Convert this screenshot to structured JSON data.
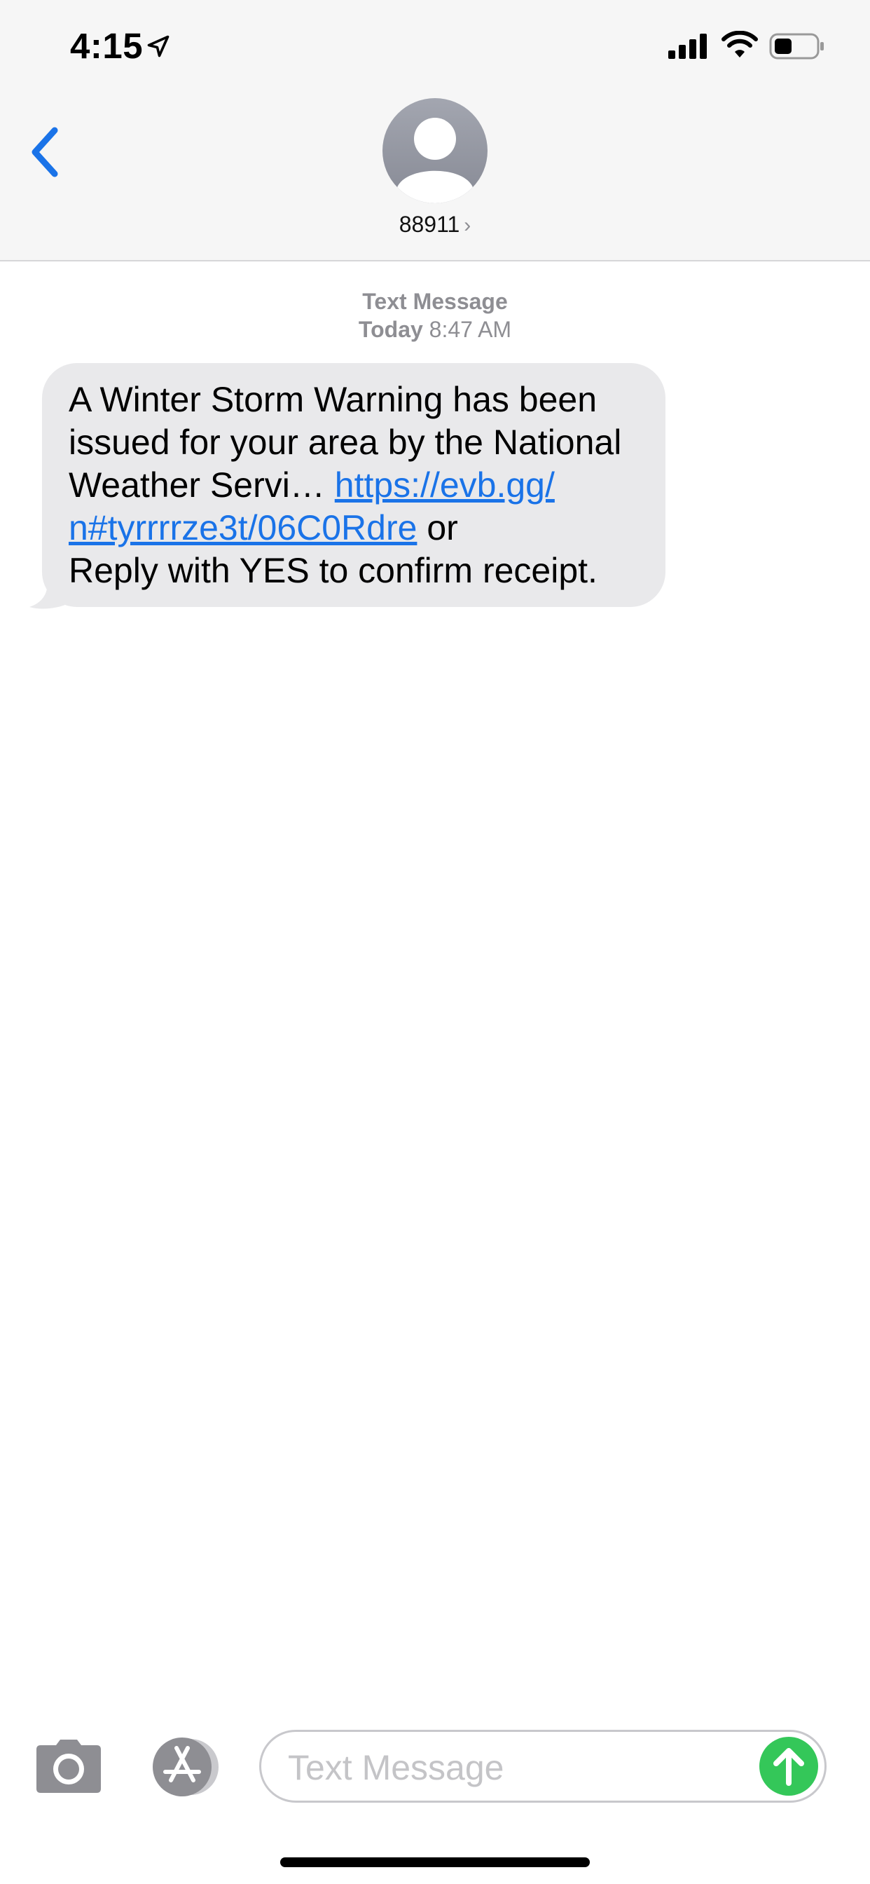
{
  "status_bar": {
    "time": "4:15",
    "icons": [
      "location-arrow-icon",
      "signal-icon",
      "wifi-icon",
      "battery-icon"
    ],
    "battery_level": 0.4
  },
  "header": {
    "back_icon": "chevron-left-icon",
    "avatar_icon": "person-icon",
    "contact_name": "88911",
    "contact_chevron": "›"
  },
  "conversation": {
    "service_label": "Text Message",
    "timestamp_day": "Today",
    "timestamp_time": "8:47 AM",
    "message": {
      "line1": "A Winter Storm Warning has been",
      "line2": "issued for your area by the National",
      "line3_text": "Weather Servi… ",
      "link_part1": "https://evb.gg/",
      "link_part2": "n#tyrrrrze3t/06C0Rdre",
      "line4_suffix": " or",
      "line5": "Reply with YES to confirm receipt."
    }
  },
  "composer": {
    "placeholder": "Text Message",
    "value": "",
    "camera_icon": "camera-icon",
    "apps_icon": "app-store-icon",
    "send_icon": "arrow-up-icon"
  },
  "colors": {
    "accent": "#1a73e8",
    "bubble_bg": "#e9e9eb",
    "send_green": "#34c759",
    "header_bg": "#f6f6f6"
  }
}
